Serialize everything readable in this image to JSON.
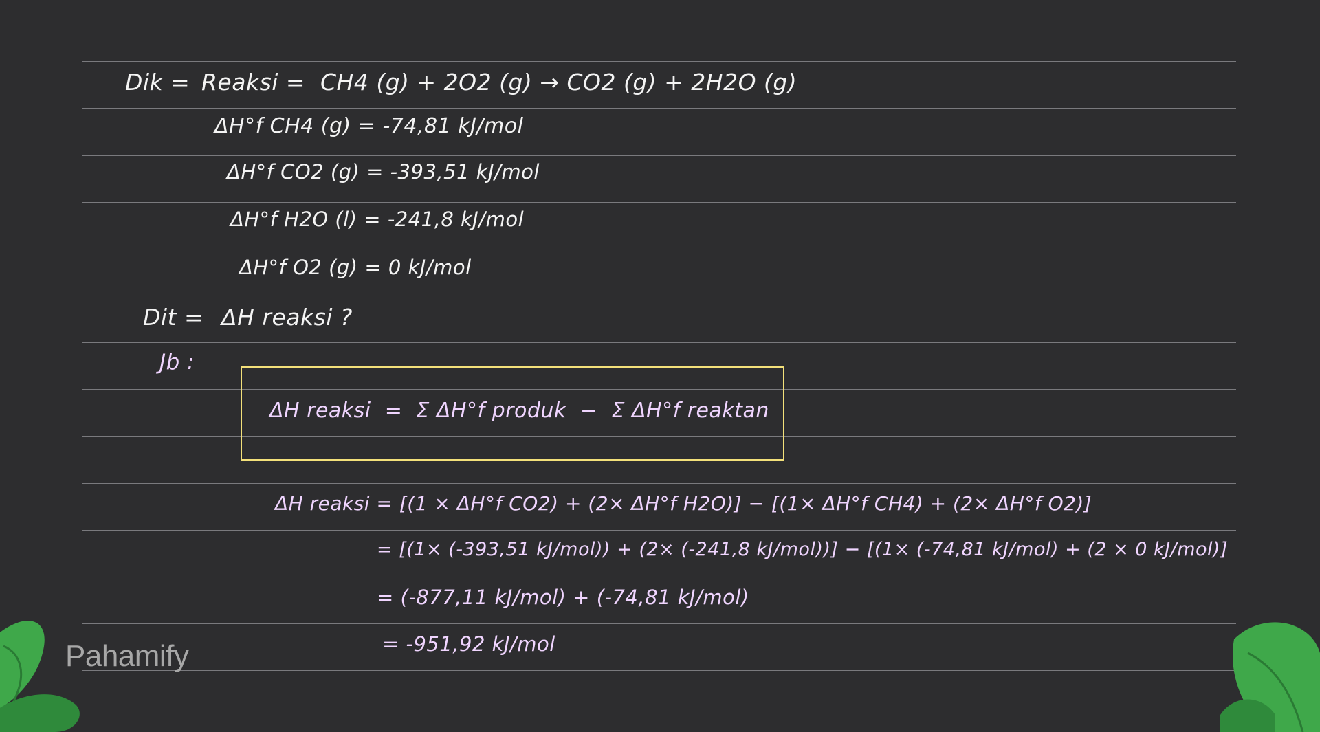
{
  "given": {
    "label": "Dik =",
    "reaction_label": "Reaksi =",
    "reaction": "CH4 (g) + 2O2 (g) → CO2 (g) + 2H2O (g)",
    "dhf_ch4": "ΔH°f CH4 (g) = -74,81 kJ/mol",
    "dhf_co2": "ΔH°f CO2 (g) = -393,51 kJ/mol",
    "dhf_h2o": "ΔH°f H2O (l) = -241,8 kJ/mol",
    "dhf_o2": "ΔH°f O2 (g) = 0 kJ/mol"
  },
  "asked": {
    "label": "Dit =",
    "question": "ΔH reaksi ?"
  },
  "answer": {
    "label": "Jb :",
    "formula": "ΔH reaksi  =  Σ ΔH°f produk  −  Σ ΔH°f reaktan",
    "step1": "ΔH reaksi = [(1 × ΔH°f CO2) + (2× ΔH°f H2O)] − [(1× ΔH°f CH4) + (2× ΔH°f O2)]",
    "step2": "= [(1× (-393,51 kJ/mol)) + (2× (-241,8 kJ/mol))] − [(1× (-74,81 kJ/mol) + (2 × 0 kJ/mol)]",
    "step3": "= (-877,11 kJ/mol) + (-74,81 kJ/mol)",
    "result": "= -951,92 kJ/mol"
  },
  "brand": {
    "name": "Pahamify"
  },
  "colors": {
    "background": "#2d2d2f",
    "chalk_white": "#f4f4f4",
    "chalk_pink": "#f0d5ff",
    "box_border": "#f3e07a",
    "leaf_green": "#3fa84a"
  }
}
